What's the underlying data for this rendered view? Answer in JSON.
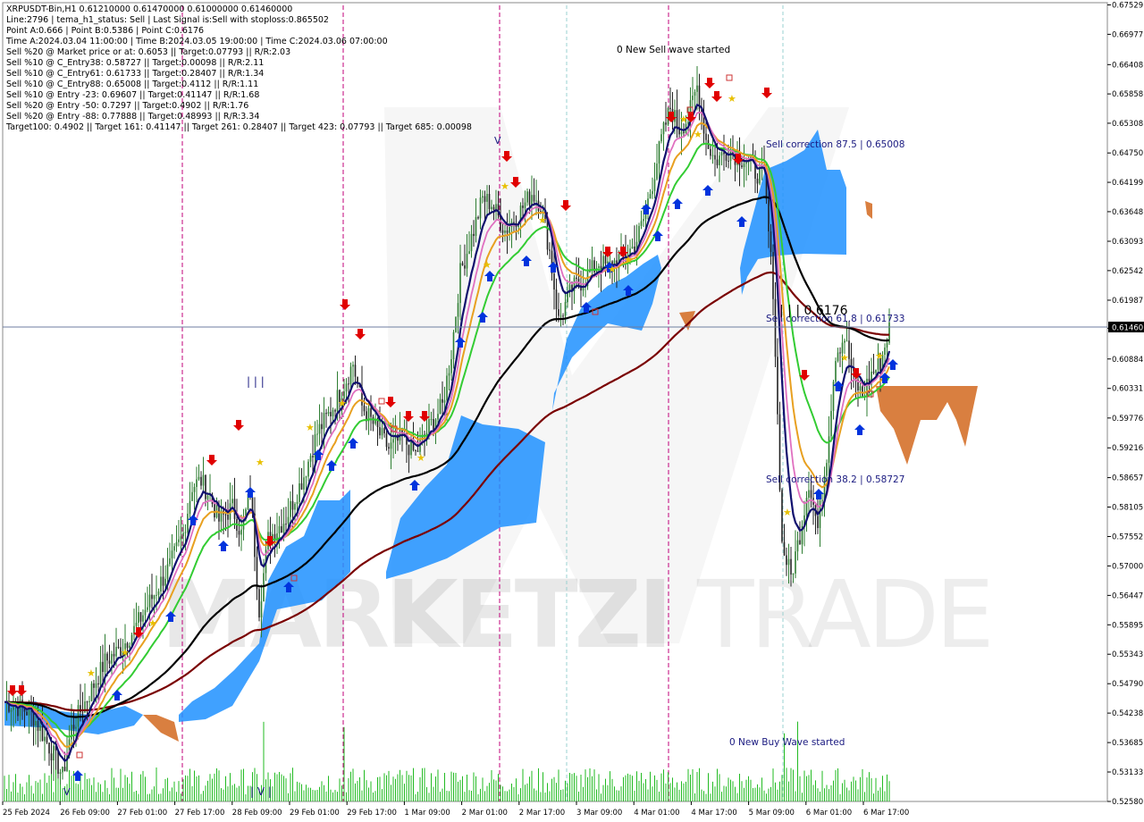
{
  "header": {
    "lines": [
      "XRPUSDT-Bin,H1  0.61210000 0.61470000 0.61000000 0.61460000",
      "Line:2796 | tema_h1_status: Sell | Last Signal is:Sell with stoploss:0.865502",
      "Point A:0.666 | Point B:0.5386 | Point C:0.6176",
      "Time A:2024.03.04 11:00:00 | Time B:2024.03.05 19:00:00 | Time C:2024.03.06 07:00:00",
      "Sell %20 @ Market price or at: 0.6053 || Target:0.07793 || R/R:2.03",
      "Sell %10 @ C_Entry38: 0.58727 || Target:0.00098 || R/R:2.11",
      "Sell %10 @ C_Entry61: 0.61733 || Target:0.28407 || R/R:1.34",
      "Sell %10 @ C_Entry88: 0.65008 || Target:0.4112 || R/R:1.11",
      "Sell %10 @ Entry -23: 0.69607 || Target:0.41147 || R/R:1.68",
      "Sell %20 @ Entry -50: 0.7297 || Target:0.4902 || R/R:1.76",
      "Sell %20 @ Entry -88: 0.77888 || Target:0.48993 || R/R:3.34",
      "Target100: 0.4902 || Target 161: 0.41147 || Target 261: 0.28407 || Target 423: 0.07793 || Target 685: 0.00098"
    ]
  },
  "annotations": {
    "sell_wave": "0 New Sell wave started",
    "buy_wave": "0 New Buy Wave started",
    "sell_corr_875": "Sell correction 87.5 | 0.65008",
    "sell_corr_618": "Sell correction 61.8 | 0.61733",
    "sell_corr_382": "Sell correction 38.2 | 0.58727",
    "point_c": "| | | 0.6176",
    "marks_top": "| | |",
    "marks_bottom": "| V |",
    "watermark_bold": "MARKETZI",
    "watermark_light": "TRADE"
  },
  "current_price": "0.61460",
  "colors": {
    "bull": "#2e7d32",
    "bear": "#222222",
    "kumo_bull": "#1e90ff",
    "kumo_bear": "#d2691e",
    "ma_navy": "#10106e",
    "ma_green": "#33cc33",
    "ma_orange": "#e8a020",
    "ma_pink": "#e070c0",
    "ma_black": "#000000",
    "ma_maroon": "#7a0000",
    "sell_arrow": "#e00000",
    "buy_arrow": "#0033dd",
    "session_line": "#c0007a",
    "volume": "#22bb22"
  },
  "chart_data": {
    "type": "candlestick",
    "symbol": "XRPUSDT-Bin",
    "timeframe": "H1",
    "ohlc_last": {
      "open": 0.6121,
      "high": 0.6147,
      "low": 0.61,
      "close": 0.6146
    },
    "ylim": [
      0.5258,
      0.6752
    ],
    "y_ticks": [
      "0.67529",
      "0.66977",
      "0.66408",
      "0.65858",
      "0.65308",
      "0.64750",
      "0.64199",
      "0.63648",
      "0.63093",
      "0.62542",
      "0.61987",
      "0.61460",
      "0.60884",
      "0.60331",
      "0.59776",
      "0.59216",
      "0.58657",
      "0.58105",
      "0.57552",
      "0.57000",
      "0.56447",
      "0.55895",
      "0.55343",
      "0.54790",
      "0.54238",
      "0.53685",
      "0.53133",
      "0.52580"
    ],
    "x_ticks": [
      "25 Feb 2024",
      "26 Feb 09:00",
      "27 Feb 01:00",
      "27 Feb 17:00",
      "28 Feb 09:00",
      "29 Feb 01:00",
      "29 Feb 17:00",
      "1 Mar 09:00",
      "2 Mar 01:00",
      "2 Mar 17:00",
      "3 Mar 09:00",
      "4 Mar 01:00",
      "4 Mar 17:00",
      "5 Mar 09:00",
      "6 Mar 01:00",
      "6 Mar 17:00"
    ],
    "levels": {
      "current": 0.6146,
      "point_a": 0.666,
      "point_b": 0.5386,
      "point_c": 0.6176,
      "corr_875": 0.65008,
      "corr_618": 0.61733,
      "corr_382": 0.58727
    },
    "close_path": [
      [
        0,
        0.5445
      ],
      [
        12,
        0.5425
      ],
      [
        22,
        0.5345
      ],
      [
        26,
        0.5305
      ],
      [
        30,
        0.5395
      ],
      [
        38,
        0.546
      ],
      [
        45,
        0.552
      ],
      [
        52,
        0.5545
      ],
      [
        58,
        0.558
      ],
      [
        66,
        0.564
      ],
      [
        74,
        0.57
      ],
      [
        80,
        0.576
      ],
      [
        84,
        0.585
      ],
      [
        88,
        0.586
      ],
      [
        92,
        0.583
      ],
      [
        96,
        0.5785
      ],
      [
        102,
        0.581
      ],
      [
        106,
        0.576
      ],
      [
        110,
        0.584
      ],
      [
        114,
        0.562
      ],
      [
        118,
        0.575
      ],
      [
        126,
        0.579
      ],
      [
        134,
        0.587
      ],
      [
        140,
        0.595
      ],
      [
        146,
        0.599
      ],
      [
        152,
        0.604
      ],
      [
        156,
        0.608
      ],
      [
        160,
        0.6
      ],
      [
        166,
        0.596
      ],
      [
        172,
        0.592
      ],
      [
        178,
        0.594
      ],
      [
        184,
        0.591
      ],
      [
        190,
        0.596
      ],
      [
        196,
        0.6
      ],
      [
        200,
        0.61
      ],
      [
        204,
        0.625
      ],
      [
        210,
        0.633
      ],
      [
        214,
        0.639
      ],
      [
        218,
        0.638
      ],
      [
        224,
        0.633
      ],
      [
        230,
        0.636
      ],
      [
        236,
        0.64
      ],
      [
        240,
        0.638
      ],
      [
        244,
        0.629
      ],
      [
        248,
        0.616
      ],
      [
        254,
        0.622
      ],
      [
        260,
        0.624
      ],
      [
        266,
        0.627
      ],
      [
        270,
        0.626
      ],
      [
        276,
        0.628
      ],
      [
        282,
        0.63
      ],
      [
        286,
        0.635
      ],
      [
        290,
        0.642
      ],
      [
        294,
        0.65
      ],
      [
        298,
        0.656
      ],
      [
        302,
        0.652
      ],
      [
        306,
        0.654
      ],
      [
        310,
        0.66
      ],
      [
        314,
        0.65
      ],
      [
        318,
        0.646
      ],
      [
        324,
        0.648
      ],
      [
        328,
        0.647
      ],
      [
        332,
        0.646
      ],
      [
        336,
        0.644
      ],
      [
        340,
        0.643
      ],
      [
        344,
        0.622
      ],
      [
        348,
        0.574
      ],
      [
        352,
        0.568
      ],
      [
        356,
        0.576
      ],
      [
        360,
        0.586
      ],
      [
        364,
        0.577
      ],
      [
        368,
        0.591
      ],
      [
        372,
        0.61
      ],
      [
        376,
        0.613
      ],
      [
        380,
        0.605
      ],
      [
        384,
        0.602
      ],
      [
        388,
        0.606
      ],
      [
        392,
        0.608
      ],
      [
        396,
        0.6146
      ]
    ]
  }
}
